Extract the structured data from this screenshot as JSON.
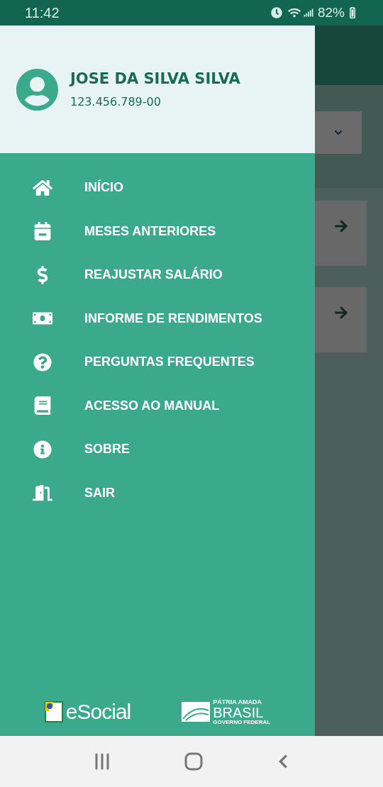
{
  "status_bar": {
    "time": "11:42",
    "battery": "82%"
  },
  "drawer": {
    "user": {
      "name": "JOSE DA SILVA SILVA",
      "document": "123.456.789-00"
    },
    "menu": [
      {
        "label": "INÍCIO"
      },
      {
        "label": "MESES ANTERIORES"
      },
      {
        "label": "REAJUSTAR SALÁRIO"
      },
      {
        "label": "INFORME DE RENDIMENTOS"
      },
      {
        "label": "PERGUNTAS FREQUENTES"
      },
      {
        "label": "ACESSO AO MANUAL"
      },
      {
        "label": "SOBRE"
      },
      {
        "label": "SAIR"
      }
    ],
    "footer": {
      "esocial": "eSocial",
      "brasil_top": "PÁTRIA AMADA",
      "brasil_main": "BRASIL",
      "brasil_bottom": "GOVERNO FEDERAL"
    }
  }
}
